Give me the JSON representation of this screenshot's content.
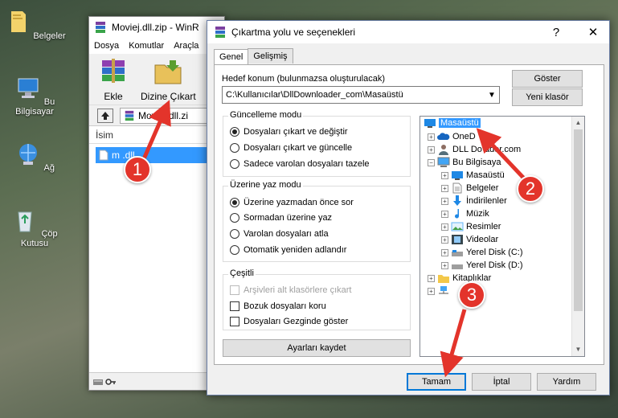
{
  "desktop": {
    "icons": [
      {
        "label": "Belgeler",
        "icon": "folder-documents-icon"
      },
      {
        "label": "Bu Bilgisayar",
        "icon": "computer-icon"
      },
      {
        "label": "Ağ",
        "icon": "network-icon"
      },
      {
        "label": "Çöp Kutusu",
        "icon": "recycle-bin-icon"
      }
    ]
  },
  "winrar": {
    "title": "Moviej.dll.zip - WinR",
    "menu": [
      "Dosya",
      "Komutlar",
      "Araçla"
    ],
    "toolbar": {
      "add_label": "Ekle",
      "extract_label": "Dizine Çıkart"
    },
    "path": "Moviej.dll.zi",
    "column_name": "İsim",
    "file_name": "m     .dll"
  },
  "dialog": {
    "title": "Çıkartma yolu ve seçenekleri",
    "help": "?",
    "close": "✕",
    "tabs": [
      "Genel",
      "Gelişmiş"
    ],
    "destination_label": "Hedef konum (bulunmazsa oluşturulacak)",
    "destination_value": "C:\\Kullanıcılar\\DllDownloader_com\\Masaüstü",
    "show_button": "Göster",
    "new_folder_button": "Yeni klasör",
    "update_mode": {
      "title": "Güncelleme modu",
      "options": [
        "Dosyaları çıkart ve değiştir",
        "Dosyaları çıkart ve güncelle",
        "Sadece varolan dosyaları tazele"
      ]
    },
    "overwrite_mode": {
      "title": "Üzerine yaz modu",
      "options": [
        "Üzerine yazmadan önce sor",
        "Sormadan üzerine yaz",
        "Varolan dosyaları atla",
        "Otomatik yeniden adlandır"
      ]
    },
    "misc": {
      "title": "Çeşitli",
      "options": [
        "Arşivleri alt klasörlere çıkart",
        "Bozuk dosyaları koru",
        "Dosyaları Gezginde göster"
      ]
    },
    "save_settings_button": "Ayarları kaydet",
    "ok_button": "Tamam",
    "cancel_button": "İptal",
    "help_button": "Yardım",
    "tree": [
      "Masaüstü",
      "OneD",
      "DLL Do          ader.com",
      "Bu Bilgisaya",
      "Masaüstü",
      "Belgeler",
      "İndirilenler",
      "Müzik",
      "Resimler",
      "Videolar",
      "Yerel Disk (C:)",
      "Yerel Disk (D:)",
      "Kitaplıklar",
      ""
    ]
  },
  "annotations": {
    "badge1": "1",
    "badge2": "2",
    "badge3": "3",
    "color": "#e3342b"
  }
}
